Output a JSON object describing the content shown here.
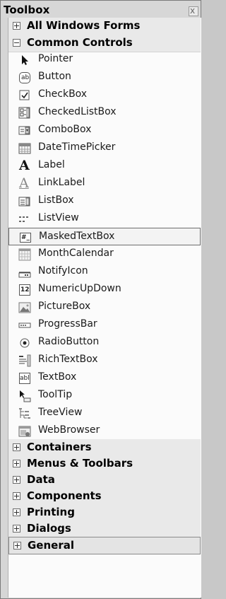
{
  "toolbox": {
    "title": "Toolbox",
    "close_glyph": "x",
    "categories_top": [
      {
        "label": "All Windows Forms",
        "expanded": false
      },
      {
        "label": "Common Controls",
        "expanded": true
      }
    ],
    "items": [
      {
        "label": "Pointer",
        "icon": "pointer-icon"
      },
      {
        "label": "Button",
        "icon": "button-icon"
      },
      {
        "label": "CheckBox",
        "icon": "checkbox-icon"
      },
      {
        "label": "CheckedListBox",
        "icon": "checkedlistbox-icon"
      },
      {
        "label": "ComboBox",
        "icon": "combobox-icon"
      },
      {
        "label": "DateTimePicker",
        "icon": "datetimepicker-icon"
      },
      {
        "label": "Label",
        "icon": "label-icon"
      },
      {
        "label": "LinkLabel",
        "icon": "linklabel-icon"
      },
      {
        "label": "ListBox",
        "icon": "listbox-icon"
      },
      {
        "label": "ListView",
        "icon": "listview-icon"
      },
      {
        "label": "MaskedTextBox",
        "icon": "maskedtextbox-icon",
        "selected": true
      },
      {
        "label": "MonthCalendar",
        "icon": "monthcalendar-icon"
      },
      {
        "label": "NotifyIcon",
        "icon": "notifyicon-icon"
      },
      {
        "label": "NumericUpDown",
        "icon": "numericupdown-icon"
      },
      {
        "label": "PictureBox",
        "icon": "picturebox-icon"
      },
      {
        "label": "ProgressBar",
        "icon": "progressbar-icon"
      },
      {
        "label": "RadioButton",
        "icon": "radiobutton-icon"
      },
      {
        "label": "RichTextBox",
        "icon": "richtextbox-icon"
      },
      {
        "label": "TextBox",
        "icon": "textbox-icon"
      },
      {
        "label": "ToolTip",
        "icon": "tooltip-icon"
      },
      {
        "label": "TreeView",
        "icon": "treeview-icon"
      },
      {
        "label": "WebBrowser",
        "icon": "webbrowser-icon"
      }
    ],
    "categories_bottom": [
      {
        "label": "Containers",
        "expanded": false
      },
      {
        "label": "Menus & Toolbars",
        "expanded": false
      },
      {
        "label": "Data",
        "expanded": false
      },
      {
        "label": "Components",
        "expanded": false
      },
      {
        "label": "Printing",
        "expanded": false
      },
      {
        "label": "Dialogs",
        "expanded": false
      },
      {
        "label": "General",
        "expanded": false
      }
    ],
    "icon_text": {
      "button": "ab",
      "label": "A",
      "linklabel": "A",
      "textbox": "abl",
      "masked": "#_",
      "numeric": "12",
      "listview": "≡≡"
    }
  }
}
